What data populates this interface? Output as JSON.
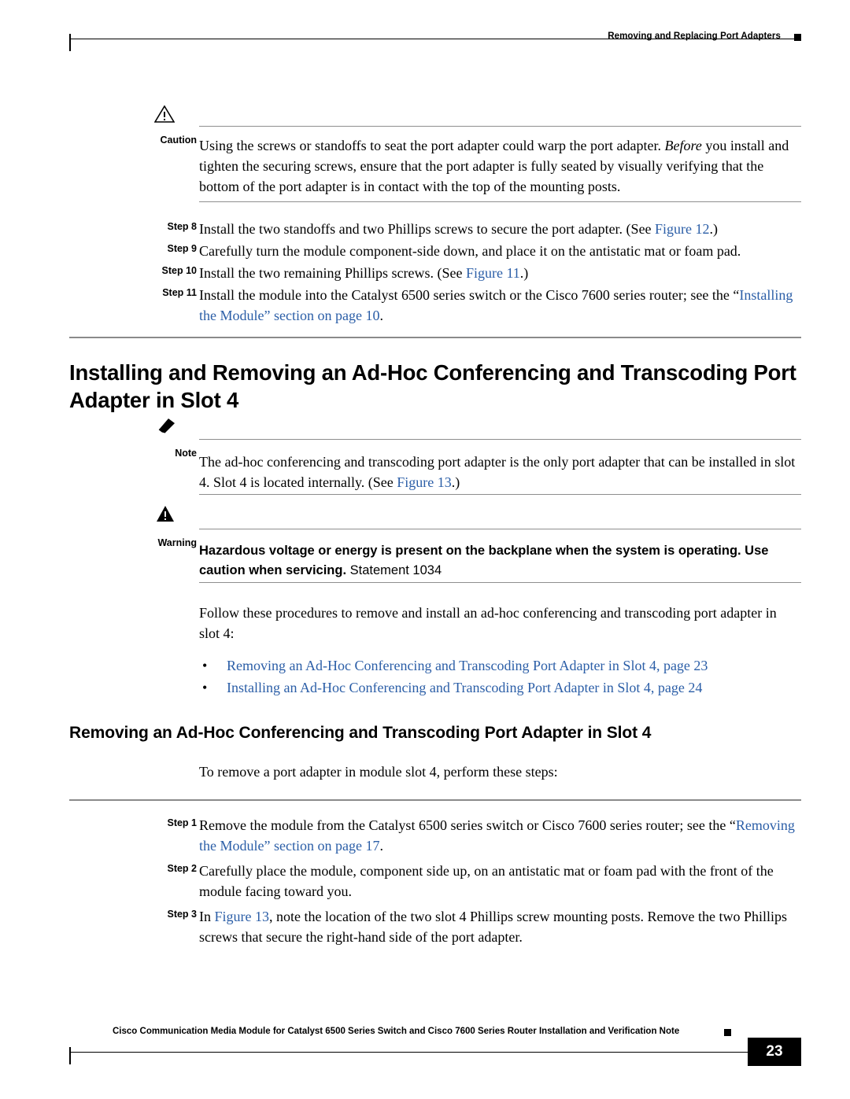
{
  "header": {
    "title": "Removing and Replacing Port Adapters"
  },
  "caution": {
    "label": "Caution",
    "icon": "caution-triangle-icon",
    "text_part1": "Using the screws or standoffs to seat the port adapter could warp the port adapter. ",
    "text_italic": "Before",
    "text_part2": " you install and tighten the securing screws, ensure that the port adapter is fully seated by visually verifying that the bottom of the port adapter is in contact with the top of the mounting posts."
  },
  "steps_top": [
    {
      "label": "Step 8",
      "text_before": "Install the two standoffs and two Phillips screws to secure the port adapter. (See ",
      "link": "Figure 12",
      "text_after": ".)"
    },
    {
      "label": "Step 9",
      "text_before": "Carefully turn the module component-side down, and place it on the antistatic mat or foam pad.",
      "link": "",
      "text_after": ""
    },
    {
      "label": "Step 10",
      "text_before": "Install the two remaining Phillips screws. (See ",
      "link": "Figure 11",
      "text_after": ".)"
    },
    {
      "label": "Step 11",
      "text_before": "Install the module into the Catalyst 6500 series switch or the Cisco 7600 series router; see the “",
      "link": "Installing the Module” section on page 10",
      "text_after": "."
    }
  ],
  "heading1": "Installing and Removing an Ad-Hoc Conferencing and Transcoding Port Adapter in Slot 4",
  "note": {
    "label": "Note",
    "icon": "note-pencil-icon",
    "text_before": "The ad-hoc conferencing and transcoding port adapter is the only port adapter that can be installed in slot 4. Slot 4 is located internally. (See ",
    "link": "Figure 13",
    "text_after": ".)"
  },
  "warning": {
    "label": "Warning",
    "icon": "warning-triangle-icon",
    "bold_text": "Hazardous voltage or energy is present on the backplane when the system is operating. Use caution when servicing.",
    "statement": " Statement 1034"
  },
  "intro_paragraph": "Follow these procedures to remove and install an ad-hoc conferencing and transcoding port adapter in slot 4:",
  "bullets": [
    {
      "marker": "•",
      "link": "Removing an Ad-Hoc Conferencing and Transcoding Port Adapter in Slot 4, page 23"
    },
    {
      "marker": "•",
      "link": "Installing an Ad-Hoc Conferencing and Transcoding Port Adapter in Slot 4, page 24"
    }
  ],
  "heading2": "Removing an Ad-Hoc Conferencing and Transcoding Port Adapter in Slot 4",
  "body_paragraph": "To remove a port adapter in module slot 4, perform these steps:",
  "steps_bottom": [
    {
      "label": "Step 1",
      "text_before": "Remove the module from the Catalyst 6500 series switch or Cisco 7600 series router; see the “",
      "link": "Removing the Module” section on page 17",
      "text_after": "."
    },
    {
      "label": "Step 2",
      "text_before": "Carefully place the module, component side up, on an antistatic mat or foam pad with the front of the module facing toward you.",
      "link": "",
      "text_after": ""
    },
    {
      "label": "Step 3",
      "text_before": "In ",
      "link": "Figure 13",
      "text_after": ", note the location of the two slot 4 Phillips screw mounting posts. Remove the two Phillips screws that secure the right-hand side of the port adapter."
    }
  ],
  "footer": {
    "text": "Cisco Communication Media Module for Catalyst 6500 Series Switch and Cisco 7600 Series Router Installation and Verification Note",
    "page_number": "23"
  }
}
